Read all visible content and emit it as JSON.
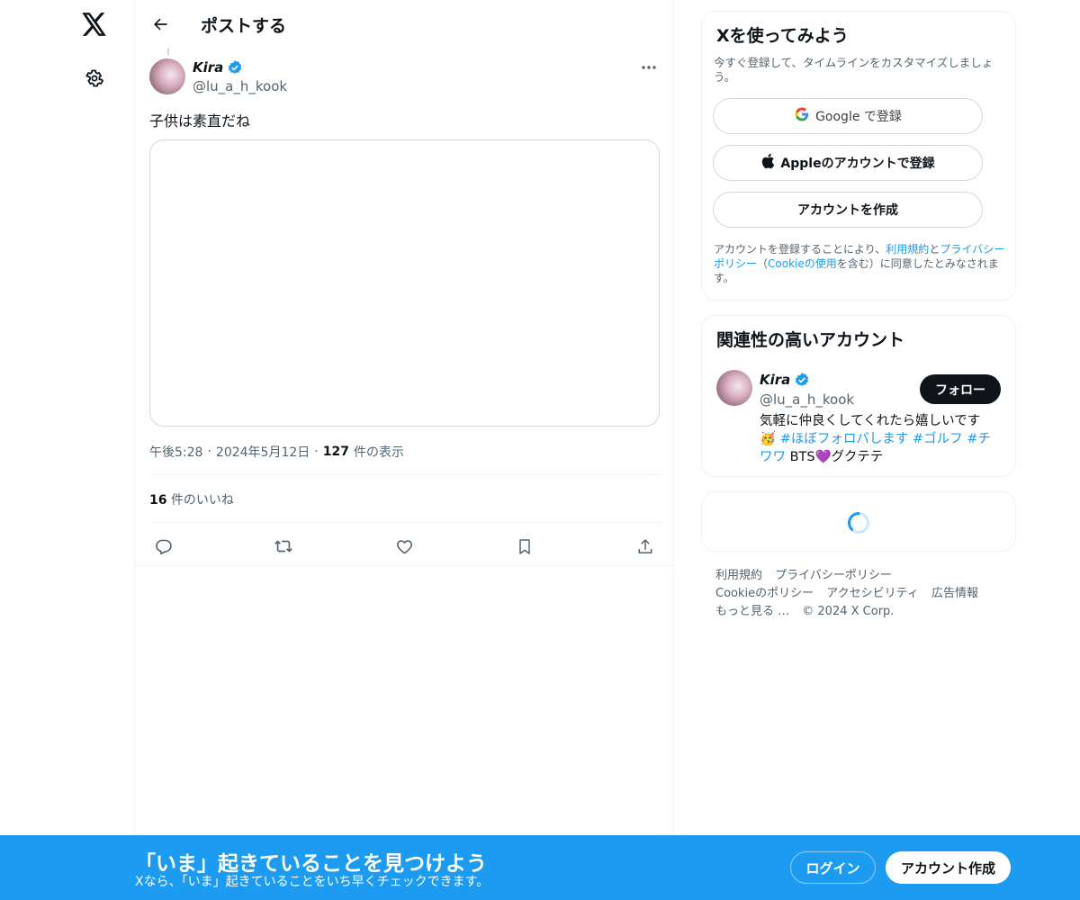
{
  "nav": {
    "logo_icon": "x-logo-icon",
    "settings_icon": "gear-icon"
  },
  "header": {
    "title": "ポストする"
  },
  "post": {
    "author_name": "Kira",
    "author_handle": "@lu_a_h_kook",
    "text": "子供は素直だね",
    "time": "午後5:28",
    "date": "2024年5月12日",
    "views_count": "127",
    "views_label": "件の表示",
    "likes_count": "16",
    "likes_label": "件のいいね",
    "separator": "·"
  },
  "signup_card": {
    "title": "Xを使ってみよう",
    "subtitle": "今すぐ登録して、タイムラインをカスタマイズしましょう。",
    "google_label": "Google で登録",
    "apple_label": "Appleのアカウントで登録",
    "create_label": "アカウントを作成",
    "terms_pre": "アカウントを登録することにより、",
    "terms_link1": "利用規約",
    "terms_and": "と",
    "terms_link2": "プライバシーポリシー",
    "terms_mid": "（",
    "terms_link3": "Cookieの使用",
    "terms_post": "を含む）に同意したとみなされます。"
  },
  "related": {
    "title": "関連性の高いアカウント",
    "name": "Kira",
    "handle": "@lu_a_h_kook",
    "follow_label": "フォロー",
    "bio_line1": "気軽に仲良くしてくれたら嬉しいです",
    "bio_emoji": "🥳",
    "bio_tags": "#ほぼフォロバします #ゴルフ #チワワ",
    "bio_tail": "BTS💜グクテテ"
  },
  "footer": {
    "links": [
      "利用規約",
      "プライバシーポリシー",
      "Cookieのポリシー",
      "アクセシビリティ",
      "広告情報",
      "もっと見る …"
    ],
    "copyright": "© 2024 X Corp."
  },
  "banner": {
    "title": "「いま」起きていることを見つけよう",
    "subtitle": "Xなら、「いま」起きていることをいち早くチェックできます。",
    "login_label": "ログイン",
    "signup_label": "アカウント作成"
  },
  "colors": {
    "accent": "#1d9bf0",
    "text": "#0f1419",
    "muted": "#536471"
  }
}
